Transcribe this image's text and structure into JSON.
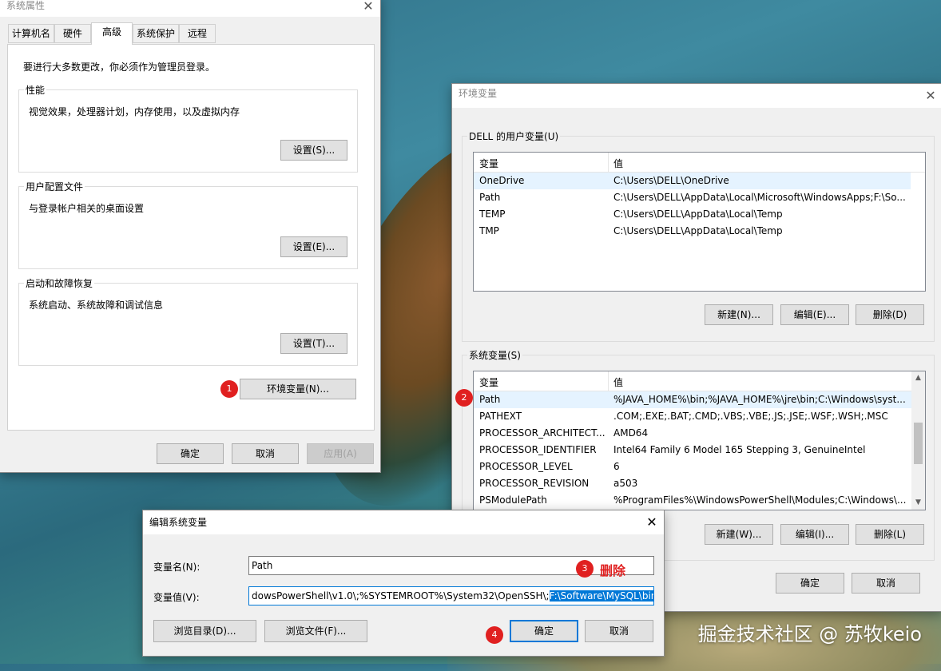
{
  "sysprop": {
    "title": "系统属性",
    "tabs": [
      "计算机名",
      "硬件",
      "高级",
      "系统保护",
      "远程"
    ],
    "admin_note": "要进行大多数更改，你必须作为管理员登录。",
    "performance": {
      "label": "性能",
      "desc": "视觉效果，处理器计划，内存使用，以及虚拟内存",
      "button": "设置(S)..."
    },
    "profile": {
      "label": "用户配置文件",
      "desc": "与登录帐户相关的桌面设置",
      "button": "设置(E)..."
    },
    "startup": {
      "label": "启动和故障恢复",
      "desc": "系统启动、系统故障和调试信息",
      "button": "设置(T)..."
    },
    "envvar_button": "环境变量(N)...",
    "ok": "确定",
    "cancel": "取消",
    "apply": "应用(A)"
  },
  "envvars": {
    "title": "环境变量",
    "user_group": "DELL 的用户变量(U)",
    "columns": [
      "变量",
      "值"
    ],
    "user_vars": [
      {
        "name": "OneDrive",
        "value": "C:\\Users\\DELL\\OneDrive"
      },
      {
        "name": "Path",
        "value": "C:\\Users\\DELL\\AppData\\Local\\Microsoft\\WindowsApps;F:\\So..."
      },
      {
        "name": "TEMP",
        "value": "C:\\Users\\DELL\\AppData\\Local\\Temp"
      },
      {
        "name": "TMP",
        "value": "C:\\Users\\DELL\\AppData\\Local\\Temp"
      }
    ],
    "user_new": "新建(N)...",
    "user_edit": "编辑(E)...",
    "user_delete": "删除(D)",
    "sys_group": "系统变量(S)",
    "sys_vars": [
      {
        "name": "Path",
        "value": "%JAVA_HOME%\\bin;%JAVA_HOME%\\jre\\bin;C:\\Windows\\syst..."
      },
      {
        "name": "PATHEXT",
        "value": ".COM;.EXE;.BAT;.CMD;.VBS;.VBE;.JS;.JSE;.WSF;.WSH;.MSC"
      },
      {
        "name": "PROCESSOR_ARCHITECT...",
        "value": "AMD64"
      },
      {
        "name": "PROCESSOR_IDENTIFIER",
        "value": "Intel64 Family 6 Model 165 Stepping 3, GenuineIntel"
      },
      {
        "name": "PROCESSOR_LEVEL",
        "value": "6"
      },
      {
        "name": "PROCESSOR_REVISION",
        "value": "a503"
      },
      {
        "name": "PSModulePath",
        "value": "%ProgramFiles%\\WindowsPowerShell\\Modules;C:\\Windows\\..."
      }
    ],
    "sys_new": "新建(W)...",
    "sys_edit": "编辑(I)...",
    "sys_delete": "删除(L)",
    "ok": "确定",
    "cancel": "取消"
  },
  "editvar": {
    "title": "编辑系统变量",
    "name_label": "变量名(N):",
    "name_value": "Path",
    "value_label": "变量值(V):",
    "value_prefix": "dowsPowerShell\\v1.0\\;%SYSTEMROOT%\\System32\\OpenSSH\\;",
    "value_selected": "F:\\Software\\MySQL\\bin;",
    "browse_dir": "浏览目录(D)...",
    "browse_file": "浏览文件(F)...",
    "ok": "确定",
    "cancel": "取消"
  },
  "annotations": {
    "m1": "1",
    "m2": "2",
    "m3": "3",
    "m4": "4",
    "delete_note": "删除"
  },
  "watermark": "掘金技术社区 @ 苏牧keio",
  "colors": {
    "accent": "#0078d7",
    "marker": "#e02020"
  },
  "icons": {
    "close": "close-icon",
    "scroll_up": "chevron-up-icon",
    "scroll_down": "chevron-down-icon"
  }
}
